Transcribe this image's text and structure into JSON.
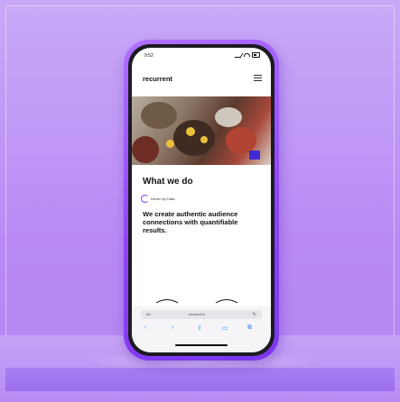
{
  "phone": {
    "status_time": "9:52"
  },
  "site": {
    "logo": "recurrent",
    "section_title": "What we do",
    "tag_label": "Driven by Data",
    "body_text": "We create authentic audience connections with quantifiable results."
  },
  "browser": {
    "aa_label": "AA",
    "url": "recurrent.io",
    "reload": "↻",
    "toolbar": {
      "back": "‹",
      "forward": "›",
      "share": "⇧",
      "bookmarks": "▭",
      "tabs": "⧉"
    }
  },
  "colors": {
    "background": "#b98af5",
    "phone_case": "#8f45f7",
    "accent": "#7a3cf0",
    "link_blue": "#2a7fff"
  }
}
